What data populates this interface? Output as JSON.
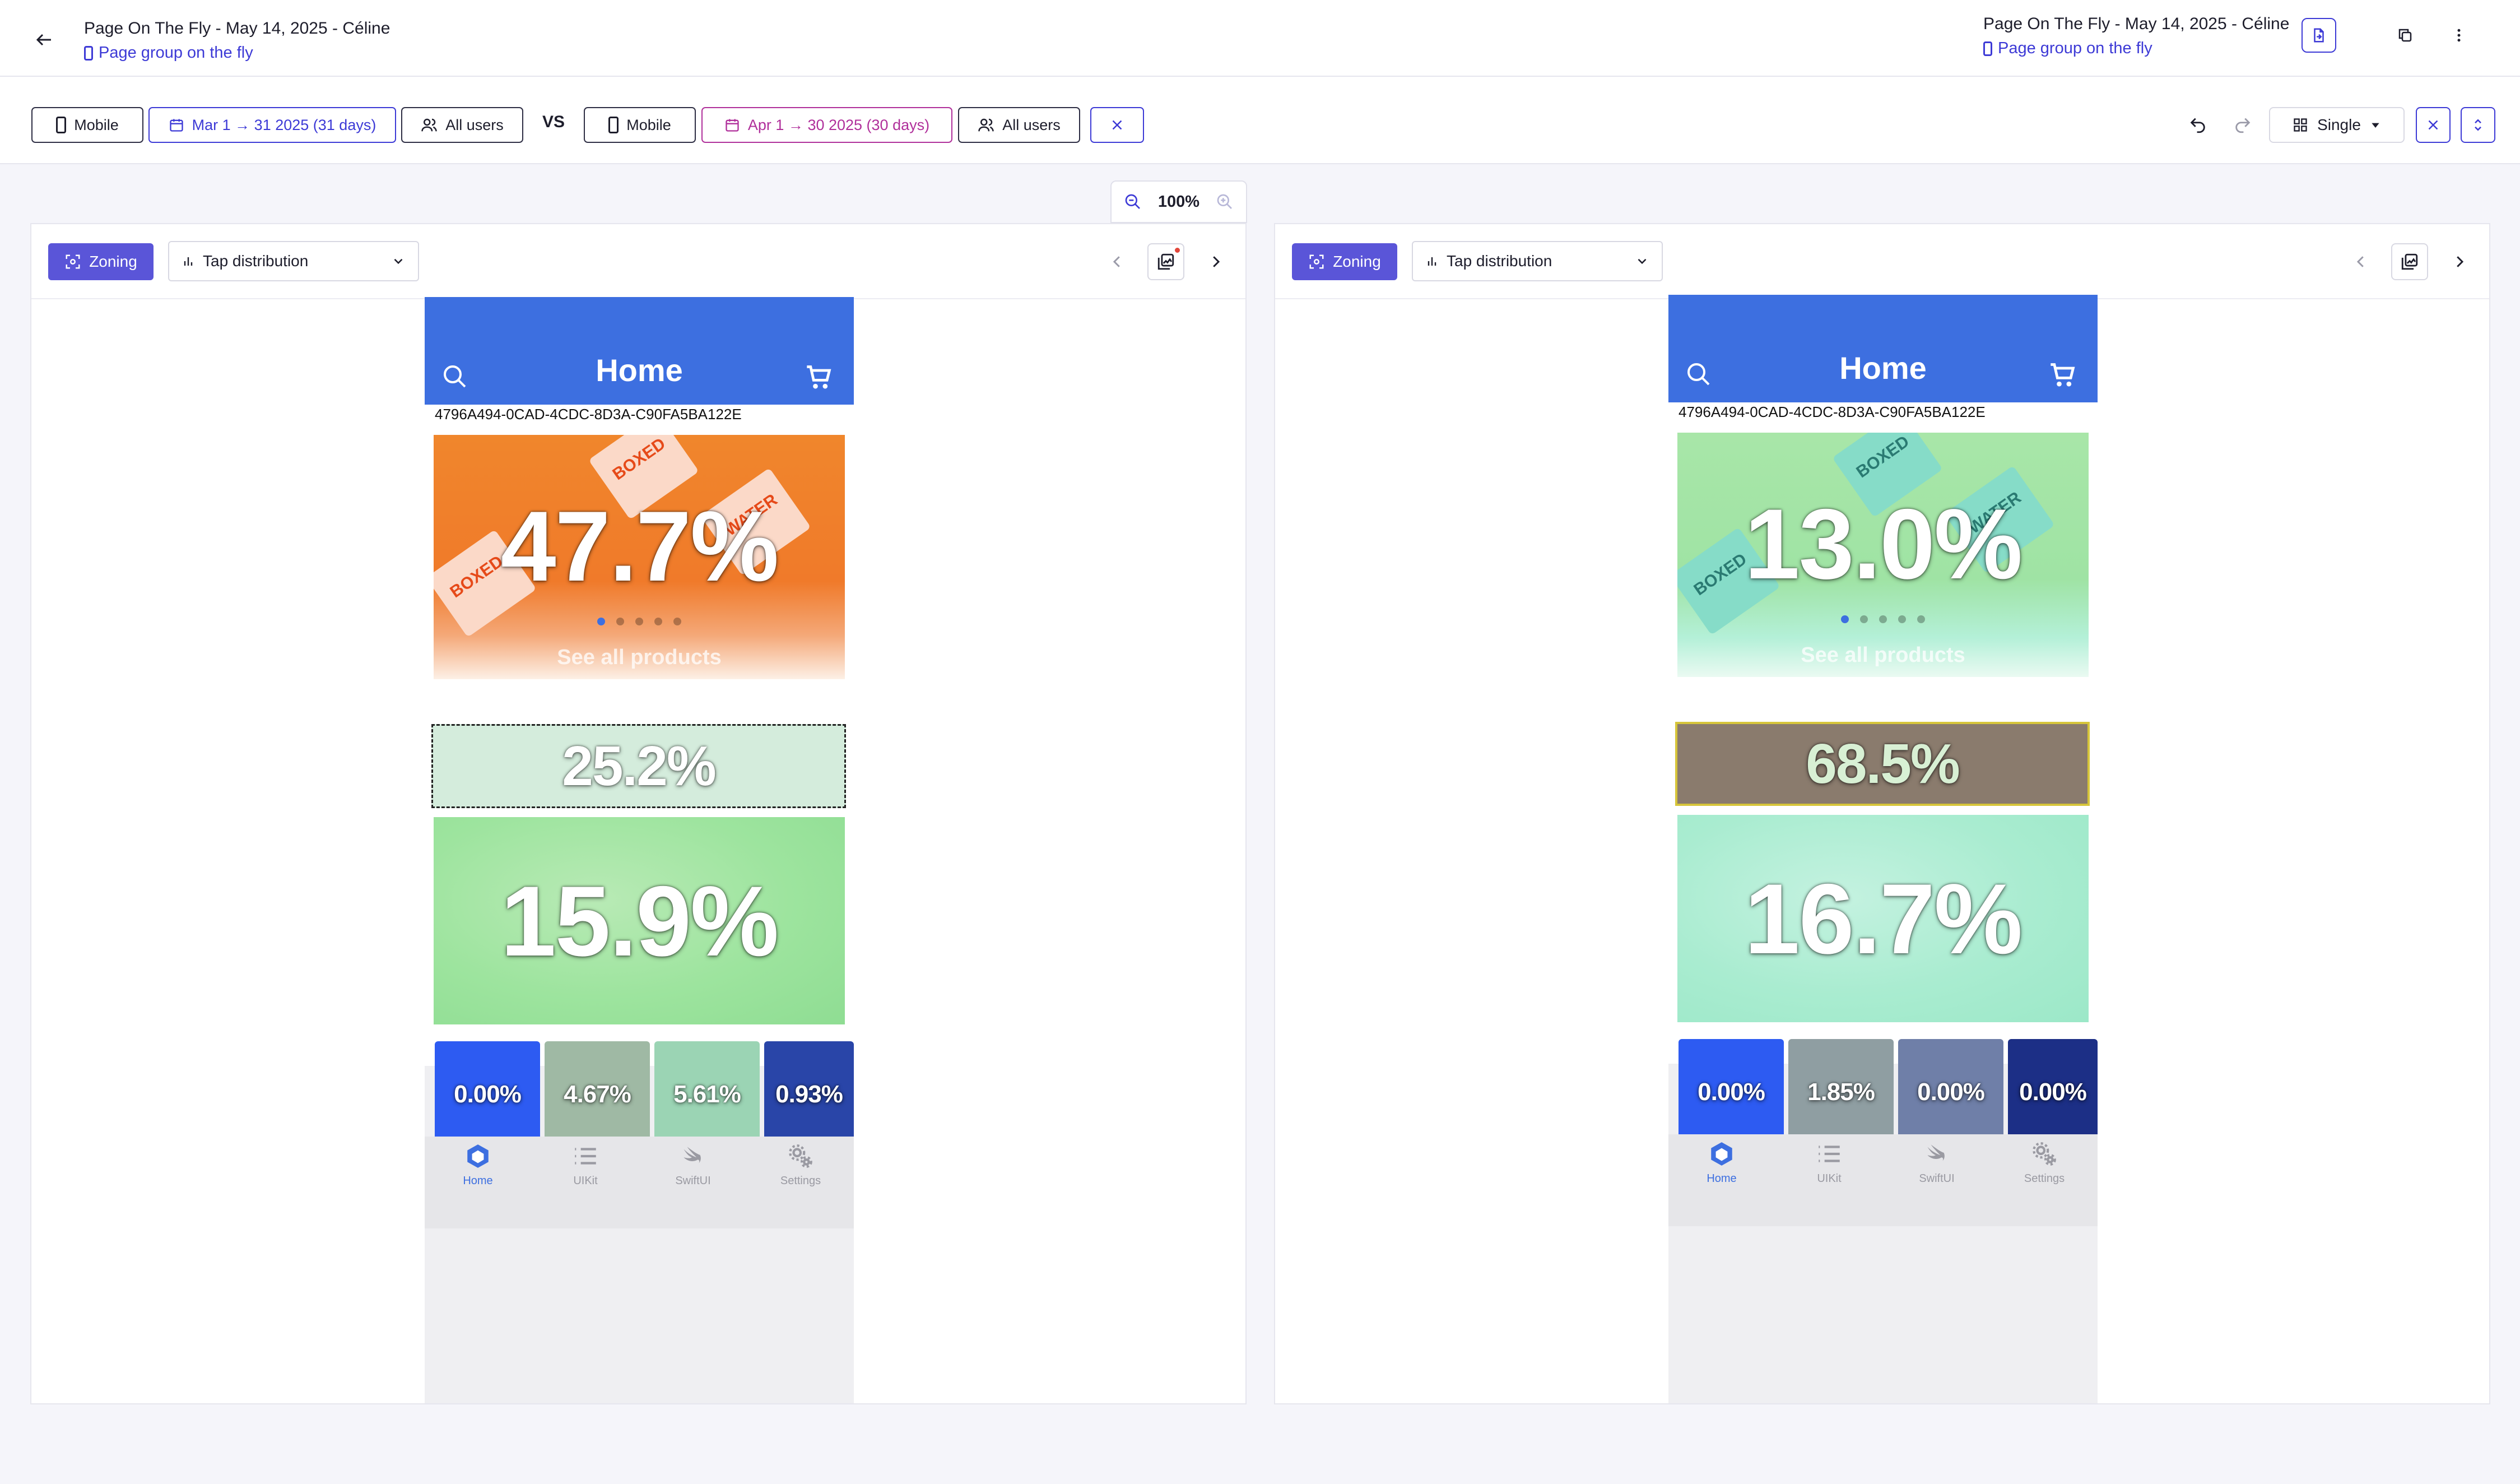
{
  "header": {
    "title": "Page On The Fly - May 14, 2025 - Céline",
    "subtitle": "Page group on the fly",
    "right_title": "Page On The Fly - May 14, 2025 - Céline",
    "right_subtitle": "Page group on the fly"
  },
  "filters": {
    "left": {
      "device": "Mobile",
      "date_range": "Mar 1 → 31 2025 (31 days)",
      "segment": "All users"
    },
    "vs_label": "VS",
    "right": {
      "device": "Mobile",
      "date_range": "Apr 1 → 30 2025 (30 days)",
      "segment": "All users"
    },
    "view_mode": "Single"
  },
  "zoom": {
    "level": "100%"
  },
  "panels": [
    {
      "mode_button": "Zoning",
      "metric_select": "Tap distribution",
      "app": {
        "title": "Home",
        "uuid": "4796A494-0CAD-4CDC-8D3A-C90FA5BA122E",
        "see_all": "See all products",
        "hero_pct": "47.7%",
        "banner_pct": "25.2%",
        "promo_pct": "15.9%",
        "tiles": [
          "0.00%",
          "4.67%",
          "5.61%",
          "0.93%"
        ],
        "tabs": [
          "Home",
          "UIKit",
          "SwiftUI",
          "Settings"
        ]
      }
    },
    {
      "mode_button": "Zoning",
      "metric_select": "Tap distribution",
      "app": {
        "title": "Home",
        "uuid": "4796A494-0CAD-4CDC-8D3A-C90FA5BA122E",
        "see_all": "See all products",
        "hero_pct": "13.0%",
        "banner_pct": "68.5%",
        "promo_pct": "16.7%",
        "tiles": [
          "0.00%",
          "1.85%",
          "0.00%",
          "0.00%"
        ],
        "tabs": [
          "Home",
          "UIKit",
          "SwiftUI",
          "Settings"
        ]
      }
    }
  ],
  "colors": {
    "accent": "#3d3ad6",
    "compare_accent": "#b0309b",
    "zoning_button": "#5a55d8",
    "app_header": "#3d6fe0"
  },
  "icons": {
    "back": "arrow-left-icon",
    "export": "file-export-icon",
    "duplicate": "copy-icon",
    "more": "more-vertical-icon",
    "undo": "undo-icon",
    "redo": "redo-icon",
    "search": "search-icon",
    "cart": "cart-icon"
  }
}
